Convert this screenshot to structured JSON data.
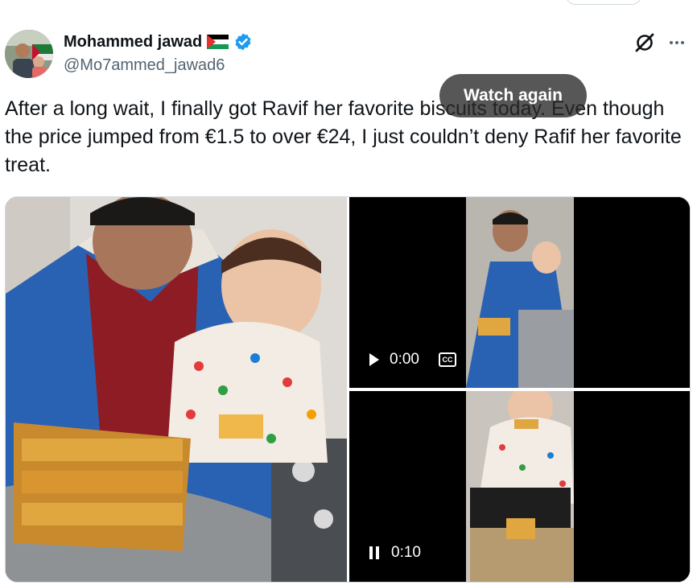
{
  "author": {
    "name": "Mohammed jawad",
    "handle": "@Mo7ammed_jawad6",
    "flag_icon": "palestine-flag-icon",
    "verified_icon": "verified-badge-icon",
    "verified_color": "#1d9bf0"
  },
  "header_icons": [
    "grok-icon",
    "more-icon"
  ],
  "tweet": {
    "text": "After a long wait, I finally got Ravif her favorite biscuits today. Even though the price jumped from €1.5 to over €24, I just couldn’t deny Rafif her favorite treat."
  },
  "media": {
    "video1": {
      "overlay_label": "Watch again",
      "time": "0:00",
      "play_icon": "play-icon",
      "captions_icon": "captions-icon",
      "captions_label": "CC"
    },
    "video2": {
      "time": "0:10",
      "pause_icon": "pause-icon"
    }
  },
  "colors": {
    "text_primary": "#0f1419",
    "text_secondary": "#536471",
    "border": "#cfd9de"
  }
}
